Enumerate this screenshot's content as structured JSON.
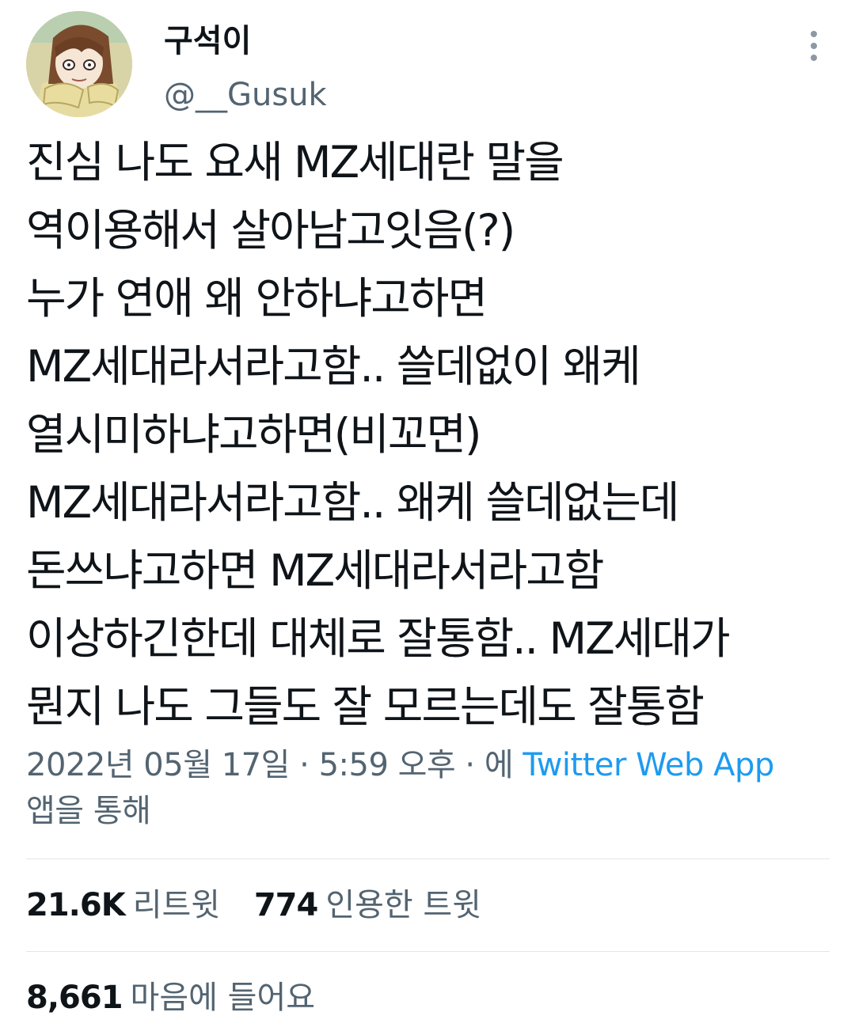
{
  "author": {
    "display_name": "구석이",
    "handle": "@__Gusuk",
    "avatar_icon": "anime-character-avatar"
  },
  "tweet": {
    "lines": [
      "진심 나도 요새 MZ세대란 말을",
      "역이용해서 살아남고잇음(?)",
      "누가 연애 왜 안하냐고하면",
      "MZ세대라서라고함.. 쓸데없이 왜케",
      "열시미하냐고하면(비꼬면)",
      "MZ세대라서라고함.. 왜케 쓸데없는데",
      "돈쓰냐고하면 MZ세대라서라고함",
      "이상하긴한데 대체로 잘통함.. MZ세대가",
      "뭔지 나도 그들도 잘 모르는데도 잘통함"
    ]
  },
  "meta": {
    "timestamp": "2022년 05월 17일 · 5:59 오후 · 에",
    "source": "Twitter Web App",
    "source_suffix": "앱을 통해"
  },
  "stats": {
    "retweets_count": "21.6K",
    "retweets_label": "리트윗",
    "quotes_count": "774",
    "quotes_label": "인용한 트윗",
    "likes_count": "8,661",
    "likes_label": "마음에 들어요"
  },
  "colors": {
    "text_primary": "#0f1419",
    "text_secondary": "#536471",
    "link": "#1d9bf0",
    "divider": "#e1e6ea"
  },
  "icons": {
    "more": "more-vertical-icon"
  }
}
